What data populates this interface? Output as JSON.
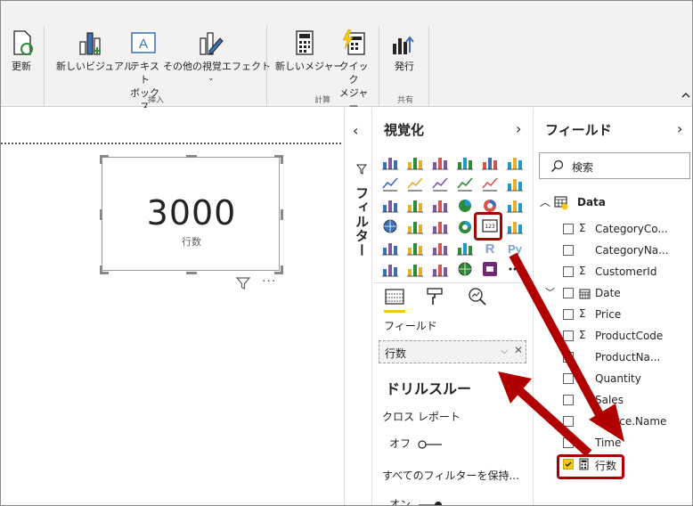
{
  "ribbon": {
    "buttons": [
      {
        "id": "refresh",
        "label": "更新"
      },
      {
        "id": "new-visual",
        "label": "新しいビジュアル"
      },
      {
        "id": "textbox",
        "label": "テキスト\nボックス"
      },
      {
        "id": "more-visuals",
        "label": "その他の視覚エフェクト"
      },
      {
        "id": "new-measure",
        "label": "新しいメジャー"
      },
      {
        "id": "quick-measure",
        "label": "クイック\nメジャー"
      },
      {
        "id": "publish",
        "label": "発行"
      }
    ],
    "groups": {
      "insert": "挿入",
      "calc": "計算",
      "share": "共有"
    }
  },
  "card": {
    "value": "3000",
    "label": "行数"
  },
  "filter_pane": {
    "title": "フィルター"
  },
  "viz_pane": {
    "title": "視覚化",
    "fields_label": "フィールド",
    "field_well_value": "行数",
    "drill_title": "ドリルスルー",
    "cross_report_label": "クロス レポート",
    "cross_report_toggle": "オフ",
    "keep_filters_label": "すべてのフィルターを保持...",
    "keep_filters_toggle": "オン"
  },
  "fields_pane": {
    "title": "フィールド",
    "search_placeholder": "検索",
    "table_name": "Data",
    "fields": [
      {
        "name": "CategoryCo...",
        "sigma": true,
        "checked": false
      },
      {
        "name": "CategoryNa...",
        "sigma": false,
        "checked": false
      },
      {
        "name": "CustomerId",
        "sigma": true,
        "checked": false
      },
      {
        "name": "Date",
        "sigma": false,
        "checked": false
      },
      {
        "name": "Price",
        "sigma": true,
        "checked": false
      },
      {
        "name": "ProductCode",
        "sigma": true,
        "checked": false
      },
      {
        "name": "ProductNa...",
        "sigma": false,
        "checked": false
      },
      {
        "name": "Quantity",
        "sigma": false,
        "checked": false
      },
      {
        "name": "Sales",
        "sigma": false,
        "checked": false
      },
      {
        "name": "Source.Name",
        "sigma": false,
        "checked": false
      },
      {
        "name": "Time",
        "sigma": false,
        "checked": false
      },
      {
        "name": "行数",
        "sigma": false,
        "checked": true
      }
    ]
  },
  "colors": {
    "accent": "#f2c811",
    "highlight": "#a80000",
    "ribbon_bg": "#f3f2f1"
  }
}
